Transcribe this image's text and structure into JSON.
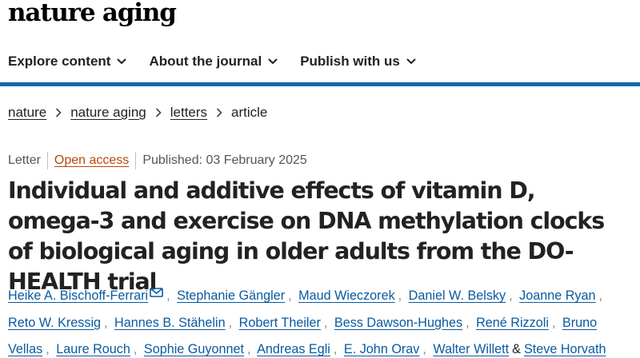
{
  "brand": {
    "logo": "nature aging"
  },
  "nav": {
    "items": [
      {
        "label": "Explore content"
      },
      {
        "label": "About the journal"
      },
      {
        "label": "Publish with us"
      }
    ]
  },
  "colors": {
    "accent": "#0f6ba8",
    "link": "#0a5aa0",
    "open_access": "#b8460a"
  },
  "breadcrumb": {
    "items": [
      {
        "label": "nature"
      },
      {
        "label": "nature aging"
      },
      {
        "label": "letters"
      }
    ],
    "current": "article"
  },
  "article": {
    "type": "Letter",
    "access": "Open access",
    "published": "Published: 03 February 2025",
    "title": "Individual and additive effects of vitamin D, omega-3 and exercise on DNA methylation clocks of biological aging in older adults from the DO-HEALTH trial",
    "authors": [
      "Heike A. Bischoff-Ferrari",
      "Stephanie Gängler",
      "Maud Wieczorek",
      "Daniel W. Belsky",
      "Joanne Ryan",
      "Reto W. Kressig",
      "Hannes B. Stähelin",
      "Robert Theiler",
      "Bess Dawson-Hughes",
      "René Rizzoli",
      "Bruno Vellas",
      "Laure Rouch",
      "Sophie Guyonnet",
      "Andreas Egli",
      "E. John Orav",
      "Walter Willett",
      "Steve Horvath"
    ],
    "last_author_joiner": "&"
  }
}
